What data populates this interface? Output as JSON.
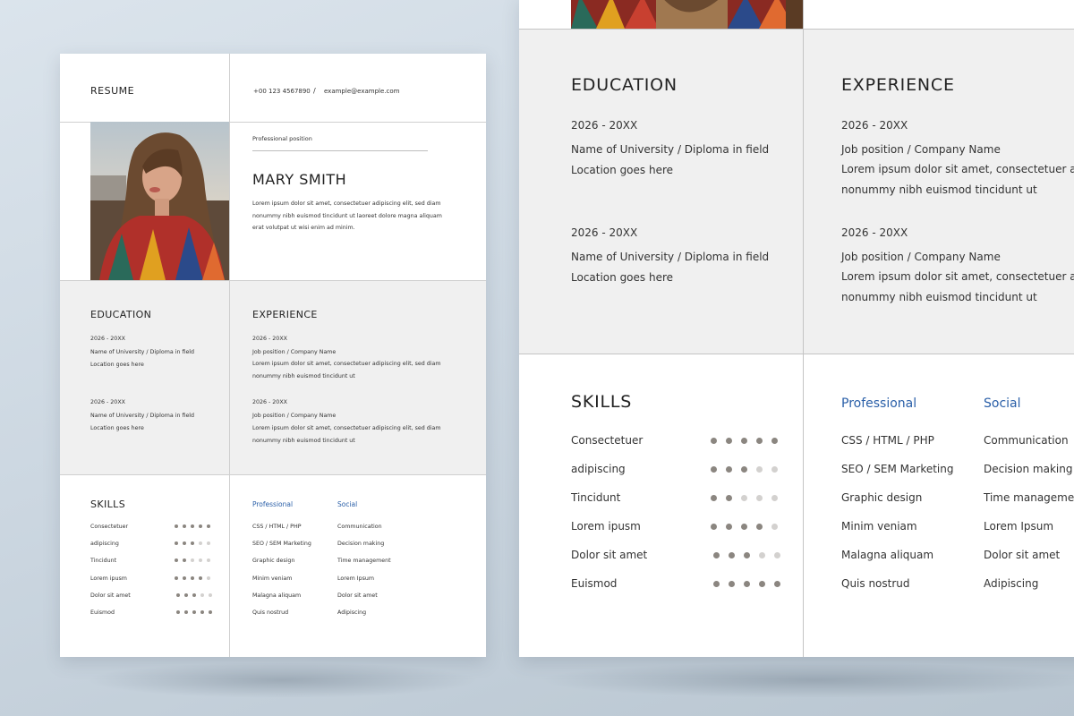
{
  "colors": {
    "accent": "#2a5fa8",
    "dot_on": "#8b8680",
    "dot_off": "#d3d1cf",
    "band": "#f0f0f0"
  },
  "resume": {
    "label": "RESUME",
    "phone": "+00 123 4567890",
    "separator": "/",
    "email": "example@example.com",
    "position_label": "Professional position",
    "name": "MARY SMITH",
    "about": "Lorem ipsum dolor sit amet, consectetuer adipiscing elit, sed diam nonummy nibh euismod tincidunt ut laoreet dolore magna aliquam erat volutpat ut wisi enim ad minim.",
    "education": {
      "heading": "EDUCATION",
      "entries": [
        {
          "years": "2026 - 20XX",
          "line1": "Name of University / Diploma in field",
          "line2": "Location goes here"
        },
        {
          "years": "2026 - 20XX",
          "line1": "Name of University / Diploma in field",
          "line2": "Location goes here"
        }
      ]
    },
    "experience": {
      "heading": "EXPERIENCE",
      "entries": [
        {
          "years": "2026 - 20XX",
          "line1": "Job position / Company Name",
          "line2": "Lorem ipsum dolor sit amet, consectetuer adipiscing elit, sed diam",
          "line3": "nonummy nibh euismod tincidunt ut"
        },
        {
          "years": "2026 - 20XX",
          "line1": "Job position / Company Name",
          "line2": "Lorem ipsum dolor sit amet, consectetuer adipiscing elit, sed diam",
          "line3": "nonummy nibh euismod tincidunt ut"
        }
      ]
    },
    "skills": {
      "heading": "SKILLS",
      "items": [
        {
          "label": "Consectetuer",
          "level": 5
        },
        {
          "label": "adipiscing",
          "level": 3
        },
        {
          "label": "Tincidunt",
          "level": 2
        },
        {
          "label": "Lorem ipusm",
          "level": 4
        },
        {
          "label": "Dolor sit amet",
          "level": 3
        },
        {
          "label": "Euismod",
          "level": 5
        }
      ],
      "max_level": 5
    },
    "professional": {
      "heading": "Professional",
      "items": [
        "CSS / HTML / PHP",
        "SEO / SEM Marketing",
        "Graphic design",
        "Minim veniam",
        "Malagna aliquam",
        "Quis nostrud"
      ]
    },
    "social": {
      "heading": "Social",
      "items": [
        "Communication",
        "Decision making",
        "Time management",
        "Lorem Ipsum",
        "Dolor sit amet",
        "Adipiscing"
      ]
    }
  },
  "zoom": {
    "experience_line2": "Lorem ipsum dolor sit amet, consectetuer adipisc"
  }
}
